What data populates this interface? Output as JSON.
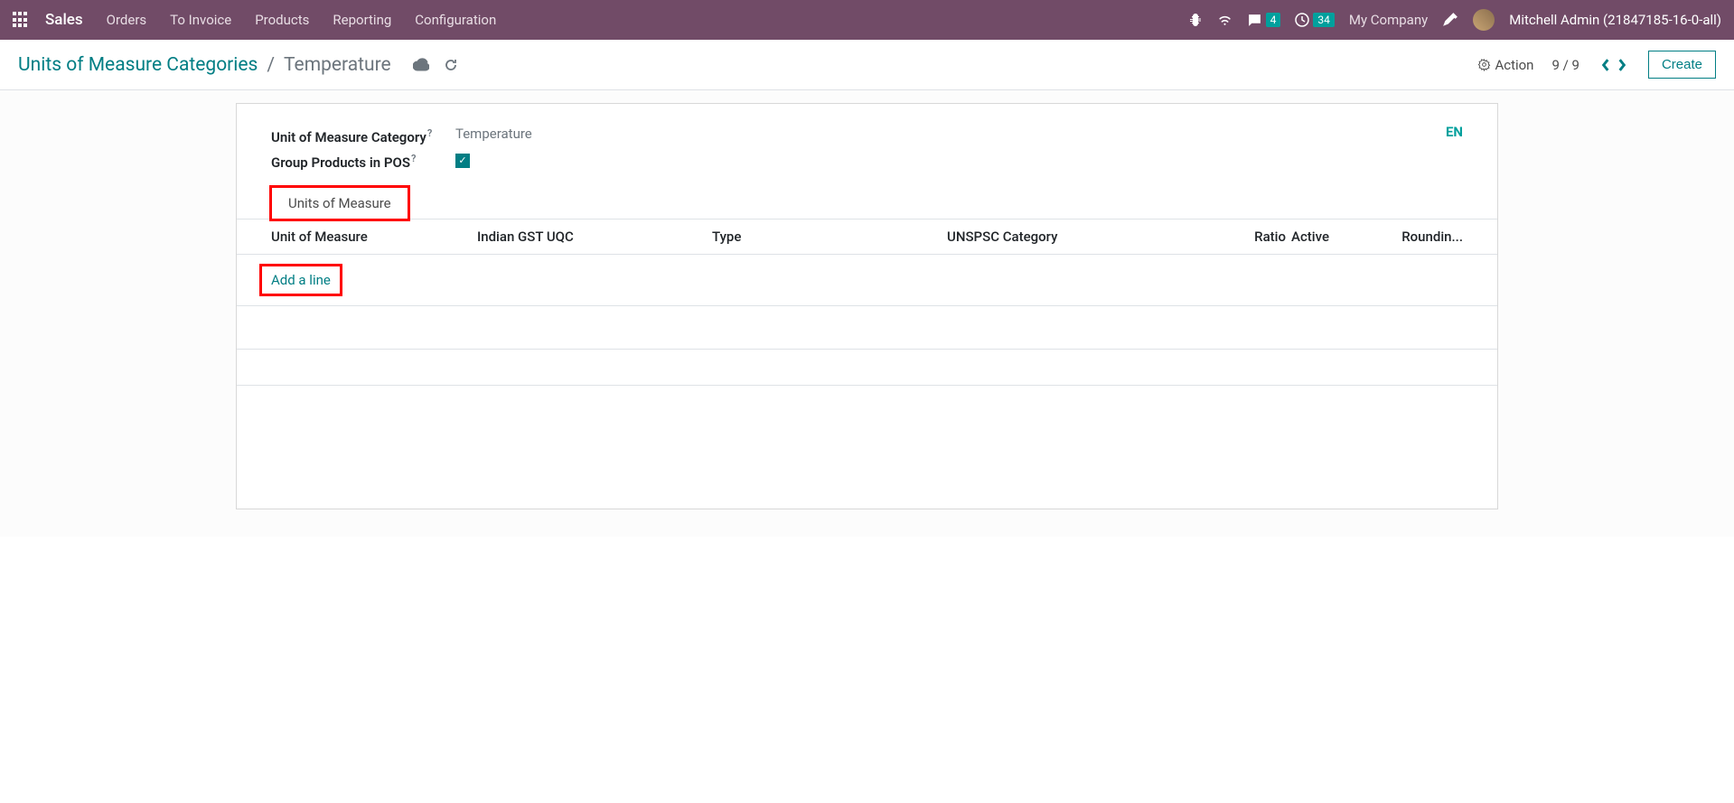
{
  "topnav": {
    "brand": "Sales",
    "items": [
      "Orders",
      "To Invoice",
      "Products",
      "Reporting",
      "Configuration"
    ],
    "chat_badge": "4",
    "clock_badge": "34",
    "company": "My Company",
    "user": "Mitchell Admin (21847185-16-0-all)"
  },
  "control_panel": {
    "bc_link": "Units of Measure Categories",
    "bc_current": "Temperature",
    "action_label": "Action",
    "pager": "9 / 9",
    "create_label": "Create"
  },
  "form": {
    "field_category_label": "Unit of Measure Category",
    "field_category_value": "Temperature",
    "field_group_label": "Group Products in POS",
    "lang": "EN"
  },
  "notebook": {
    "tab_label": "Units of Measure",
    "columns": {
      "uom": "Unit of Measure",
      "gst": "Indian GST UQC",
      "type": "Type",
      "unspsc": "UNSPSC Category",
      "ratio": "Ratio",
      "active": "Active",
      "rounding": "Roundin..."
    },
    "add_line": "Add a line"
  }
}
